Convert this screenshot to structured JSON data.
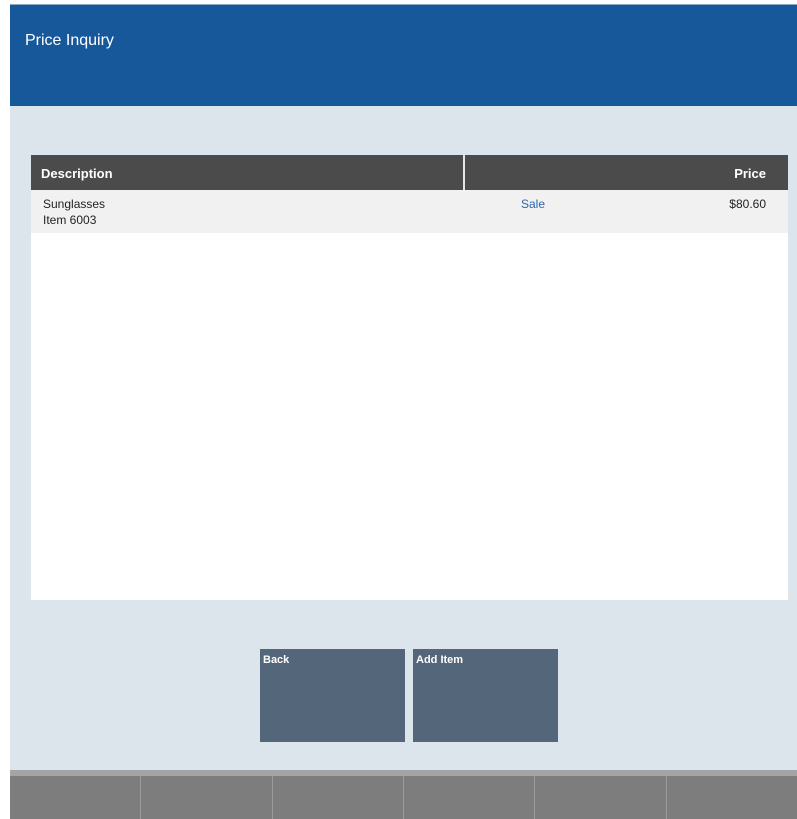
{
  "header": {
    "title": "Price Inquiry"
  },
  "table": {
    "columns": {
      "description": "Description",
      "price": "Price"
    },
    "rows": [
      {
        "name": "Sunglasses",
        "item": "Item 6003",
        "status": "Sale",
        "price": "$80.60"
      }
    ]
  },
  "buttons": {
    "back": "Back",
    "add_item": "Add Item"
  },
  "colors": {
    "title_bar": "#17589b",
    "background": "#dde5ec",
    "table_header": "#4b4b4b",
    "button": "#53667a",
    "sale_link": "#2c67b0",
    "function_bar": "#7d7d7d"
  }
}
